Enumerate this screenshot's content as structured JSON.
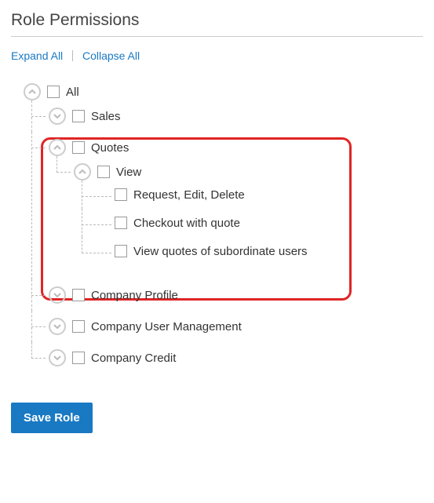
{
  "title": "Role Permissions",
  "actions": {
    "expand": "Expand All",
    "collapse": "Collapse All"
  },
  "tree": {
    "all": "All",
    "sales": "Sales",
    "quotes": "Quotes",
    "view": "View",
    "req": "Request, Edit, Delete",
    "checkout": "Checkout with quote",
    "subord": "View quotes of subordinate users",
    "profile": "Company Profile",
    "userMgmt": "Company User Management",
    "credit": "Company Credit"
  },
  "saveLabel": "Save Role"
}
